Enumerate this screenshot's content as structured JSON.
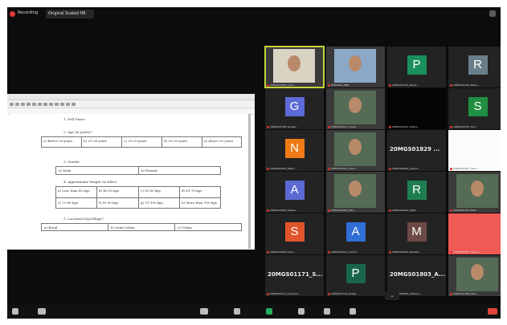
{
  "topbar": {
    "recording": "Recording",
    "viewing": "Original Scaled HR"
  },
  "document": {
    "lines": [
      "1. Full Name:",
      "2. Age (in years)?",
      "3. Gender",
      "4. Approximate Weight (in Kilos)",
      "5. Location/City/Village?"
    ],
    "age_options": [
      "a) Below 20 years",
      "b) 21-24 years",
      "c) 25-29 years",
      "d) 25-29 years",
      "e) Above 29 years"
    ],
    "gender_options": [
      "a) Male",
      "b) Female"
    ],
    "weight_options": [
      "a) Less than 40 kgs",
      "b) 40-50 kgs",
      "c) 51-60 kgs",
      "d) 61-70 kgs",
      "e) 71-80 kgs",
      "f) 81-90 kgs",
      "g) 91-100 kgs",
      "h) More than 100 kgs"
    ],
    "location_options": [
      "a) Rural",
      "b) Semi-Urban",
      "c) Urban"
    ]
  },
  "gallery": [
    {
      "type": "video",
      "name": "20MGS01765_Sovit..."
    },
    {
      "type": "video",
      "name": "20MGS01_PNP..."
    },
    {
      "type": "avatar",
      "letter": "P",
      "color": "#1b8f5d",
      "name": "20MGS01741_Bhupi..."
    },
    {
      "type": "avatar",
      "letter": "R",
      "color": "#6b7f8a",
      "name": "20MGS01760_Rahul..."
    },
    {
      "type": "avatar",
      "letter": "G",
      "color": "#5d6bd6",
      "name": "20MGS01789_Ganga..."
    },
    {
      "type": "video",
      "name": "20MGS01021_Anush..."
    },
    {
      "type": "dark",
      "name": "20MGS01101_Subha..."
    },
    {
      "type": "avatar",
      "letter": "S",
      "color": "#1f8f41",
      "name": "20MGS01070_Tanu"
    },
    {
      "type": "avatar",
      "letter": "N",
      "color": "#ef7a16",
      "name": "20MGS01055_Nikhil..."
    },
    {
      "type": "video",
      "name": "20MGS01100_Vivek..."
    },
    {
      "type": "text",
      "text": "20MGS01829 ...",
      "name": "20MGS01829_Joseph..."
    },
    {
      "type": "white",
      "name": "20MGS01167_Vipul..."
    },
    {
      "type": "avatar",
      "letter": "A",
      "color": "#5a6ad2",
      "name": "20MGS01820_Abhish..."
    },
    {
      "type": "video",
      "name": "20MGS01156_Shiv..."
    },
    {
      "type": "avatar",
      "letter": "R",
      "color": "#1f7e50",
      "name": "20MGS01001_Rajat..."
    },
    {
      "type": "video",
      "name": "20MGS01763_Ritik..."
    },
    {
      "type": "avatar",
      "letter": "S",
      "color": "#e1542b",
      "name": "20MGS01054_Sonu..."
    },
    {
      "type": "avatar",
      "letter": "A",
      "color": "#2f6fd6",
      "name": "20MGS01102_Anirbh..."
    },
    {
      "type": "avatar",
      "letter": "M",
      "color": "#6d4a45",
      "name": "20MGS01200_Mukesh..."
    },
    {
      "type": "red",
      "name": "20MGS01887_Saurav..."
    },
    {
      "type": "text",
      "text": "20MGS01171_S...",
      "name": "20MGS01171_Suvendu..."
    },
    {
      "type": "avatar",
      "letter": "P",
      "color": "#17664c",
      "name": "20MGS01716_Pratap"
    },
    {
      "type": "text",
      "text": "20MGS01803_A...",
      "name": "20MGS01803_Abhinav..."
    },
    {
      "type": "video",
      "name": "20MGS01788_Yash..."
    }
  ],
  "colors": {
    "active_border": "#c6d43a",
    "mic_off": "#d33"
  }
}
